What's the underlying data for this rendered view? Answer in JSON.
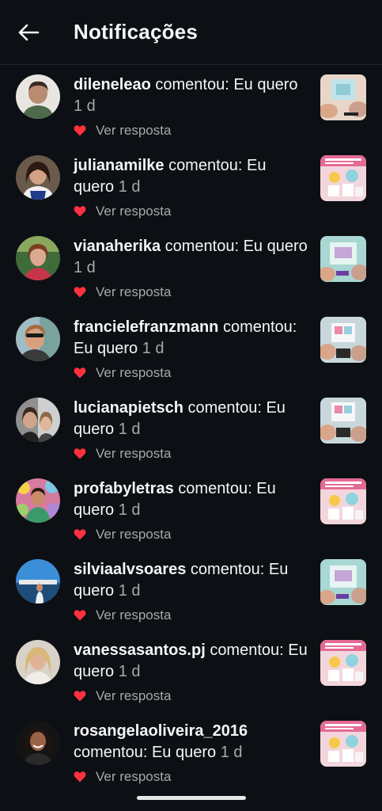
{
  "header": {
    "title": "Notificações",
    "back_icon": "arrow-left-icon"
  },
  "colors": {
    "background": "#0c1014",
    "text": "#f5f5f5",
    "muted": "#a8a8a8",
    "heart": "#ff3040"
  },
  "notifications": [
    {
      "username": "dileneleao",
      "action": "comentou:",
      "comment": "Eu quero",
      "time": "1 d",
      "reply_label": "Ver resposta"
    },
    {
      "username": "julianamilke",
      "action": "comentou:",
      "comment": "Eu quero",
      "time": "1 d",
      "reply_label": "Ver resposta"
    },
    {
      "username": "vianaherika",
      "action": "comentou:",
      "comment": "Eu quero",
      "time": "1 d",
      "reply_label": "Ver resposta"
    },
    {
      "username": "francielefranzmann",
      "action": "comentou:",
      "comment": "Eu quero",
      "time": "1 d",
      "reply_label": "Ver resposta"
    },
    {
      "username": "lucianapietsch",
      "action": "comentou:",
      "comment": "Eu quero",
      "time": "1 d",
      "reply_label": "Ver resposta"
    },
    {
      "username": "profabyletras",
      "action": "comentou:",
      "comment": "Eu quero",
      "time": "1 d",
      "reply_label": "Ver resposta"
    },
    {
      "username": "silviaalvsoares",
      "action": "comentou:",
      "comment": "Eu quero",
      "time": "1 d",
      "reply_label": "Ver resposta"
    },
    {
      "username": "vanessasantos.pj",
      "action": "comentou:",
      "comment": "Eu quero",
      "time": "1 d",
      "reply_label": "Ver resposta"
    },
    {
      "username": "rosangelaoliveira_2016",
      "action": "comentou:",
      "comment": "Eu quero",
      "time": "1 d",
      "reply_label": "Ver resposta"
    }
  ]
}
